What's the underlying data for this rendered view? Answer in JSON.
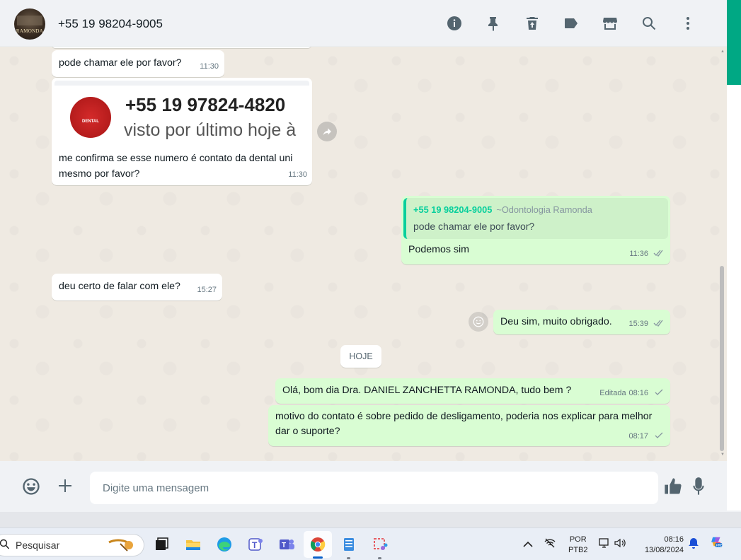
{
  "header": {
    "contact_name": "+55 19 98204-9005",
    "avatar_text": "RAMONDA",
    "icons": [
      "info-icon",
      "pin-icon",
      "delete-icon",
      "label-icon",
      "catalog-icon",
      "search-icon",
      "menu-icon"
    ]
  },
  "messages": [
    {
      "id": "m1",
      "direction": "in",
      "text": "pode chamar ele por favor?",
      "time": "11:30"
    },
    {
      "id": "m2",
      "direction": "in",
      "preview": {
        "number": "+55 19 97824-4820",
        "status": "visto por último hoje à",
        "logo_text": "DENTAL"
      },
      "text": "me confirma se esse numero é contato da dental uni mesmo por favor?",
      "time": "11:30"
    },
    {
      "id": "m3",
      "direction": "out",
      "quote": {
        "author": "+55 19 98204-9005",
        "push_name": "~Odontologia Ramonda",
        "text": "pode chamar ele por favor?"
      },
      "text": "Podemos sim",
      "time": "11:36",
      "status": "read"
    },
    {
      "id": "m4",
      "direction": "in",
      "text": "deu certo de falar com ele?",
      "time": "15:27"
    },
    {
      "id": "m5",
      "direction": "out",
      "text": "Deu sim, muito obrigado.",
      "time": "15:39",
      "status": "read"
    },
    {
      "id": "m6",
      "direction": "out",
      "text": "Olá, bom dia Dra. DANIEL ZANCHETTA RAMONDA, tudo bem ?",
      "edited_label": "Editada",
      "time": "08:16",
      "status": "sent"
    },
    {
      "id": "m7",
      "direction": "out",
      "text": "motivo do contato é  sobre pedido de desligamento, poderia nos explicar para melhor dar o suporte?",
      "time": "08:17",
      "status": "sent"
    }
  ],
  "date_divider": "HOJE",
  "composer": {
    "placeholder": "Digite uma mensagem",
    "value": ""
  },
  "taskbar": {
    "search_placeholder": "Pesquisar",
    "language": "POR",
    "keyboard": "PTB2",
    "time": "08:16",
    "date": "13/08/2024",
    "copilot_badge": "PRE"
  },
  "colors": {
    "accent": "#00a884",
    "outgoing_bubble": "#d9fdd3",
    "incoming_bubble": "#ffffff",
    "chat_bg": "#efeae2",
    "read_ticks": "#53bdeb"
  }
}
